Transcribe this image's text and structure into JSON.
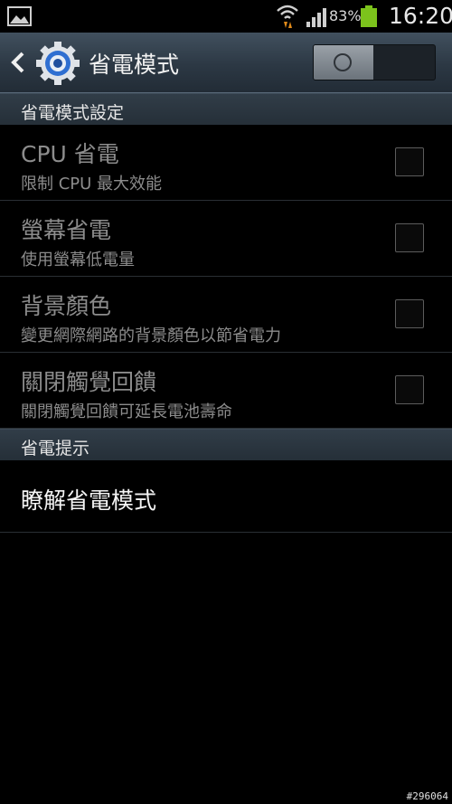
{
  "status_bar": {
    "battery_percent": "83%",
    "time": "16:20",
    "icons": [
      "gallery-icon",
      "wifi-icon",
      "signal-icon",
      "battery-icon"
    ],
    "battery_level": 0.83,
    "battery_color": "#7cc31c"
  },
  "action_bar": {
    "title": "省電模式",
    "toggle_state": "off",
    "icons": [
      "back-icon",
      "settings-gear-icon"
    ]
  },
  "sections": [
    {
      "header": "省電模式設定",
      "items": [
        {
          "title": "CPU 省電",
          "subtitle": "限制 CPU 最大效能",
          "checked": false
        },
        {
          "title": "螢幕省電",
          "subtitle": "使用螢幕低電量",
          "checked": false
        },
        {
          "title": "背景顏色",
          "subtitle": "變更網際網路的背景顏色以節省電力",
          "checked": false
        },
        {
          "title": "關閉觸覺回饋",
          "subtitle": "關閉觸覺回饋可延長電池壽命",
          "checked": false
        }
      ]
    },
    {
      "header": "省電提示",
      "items": [
        {
          "title": "瞭解省電模式"
        }
      ]
    }
  ],
  "watermark": "#296064",
  "colors": {
    "accent_blue": "#2f6fd1",
    "disabled_text": "#8c8c8c"
  }
}
